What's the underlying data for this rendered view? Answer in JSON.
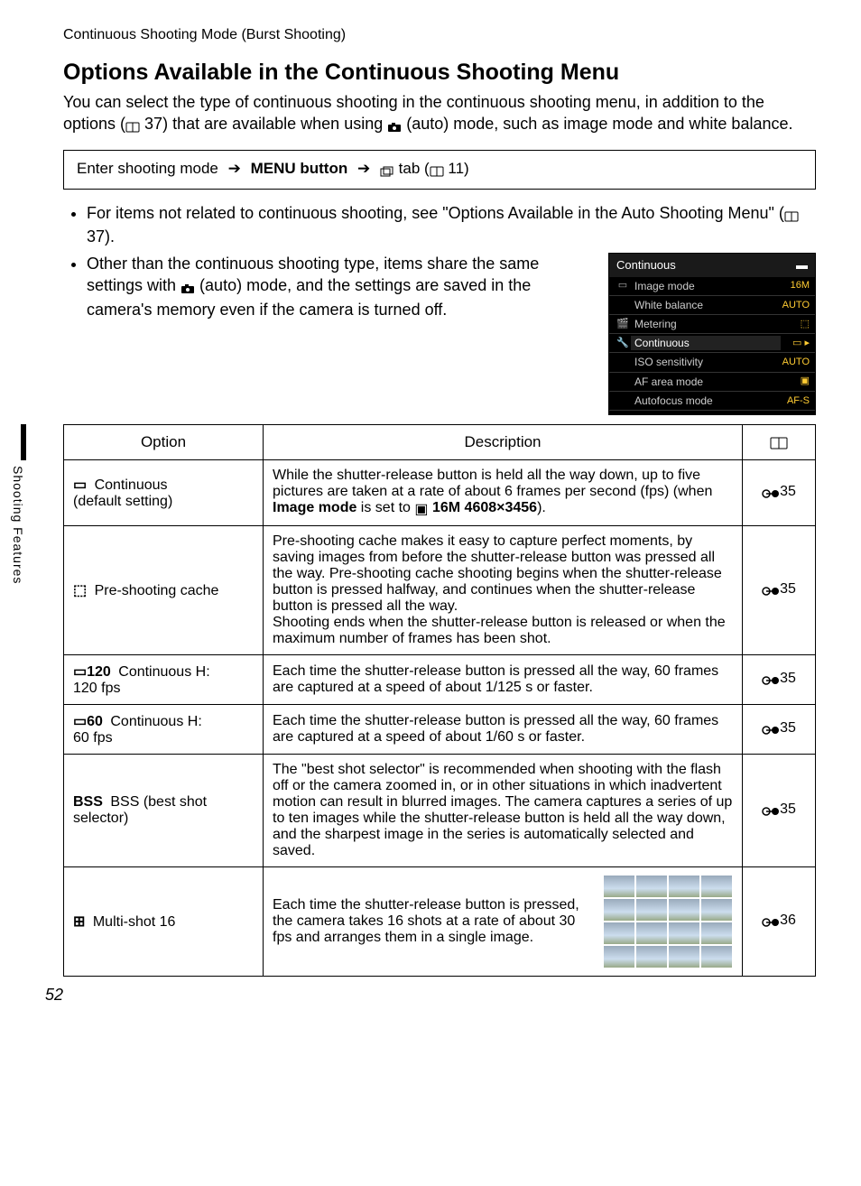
{
  "running_head": "Continuous Shooting Mode (Burst Shooting)",
  "section_title": "Options Available in the Continuous Shooting Menu",
  "intro_a": "You can select the type of continuous shooting in the continuous shooting menu, in addition to the options (",
  "intro_ref1": " 37) that are available when using ",
  "intro_b": " (auto) mode, such as image mode and white balance.",
  "nav": {
    "a": "Enter shooting mode ",
    "b": " MENU button ",
    "c": " tab (",
    "ref": " 11)"
  },
  "bullets": {
    "b1a": "For items not related to continuous shooting, see \"Options Available in the Auto Shooting Menu\" (",
    "b1b": " 37).",
    "b2a": "Other than the continuous shooting type, items share the same settings with ",
    "b2b": " (auto) mode, and the settings are saved in the camera's memory even if the camera is turned off."
  },
  "menu": {
    "title": "Continuous",
    "items": [
      {
        "label": "Image mode",
        "val": "16M"
      },
      {
        "label": "White balance",
        "val": "AUTO"
      },
      {
        "label": "Metering",
        "val": "⬚"
      },
      {
        "label": "Continuous",
        "val": "▭ ▸"
      },
      {
        "label": "ISO sensitivity",
        "val": "AUTO"
      },
      {
        "label": "AF area mode",
        "val": "▣"
      },
      {
        "label": "Autofocus mode",
        "val": "AF-S"
      }
    ]
  },
  "table": {
    "headers": {
      "opt": "Option",
      "desc": "Description",
      "ref": ""
    },
    "rows": [
      {
        "opt_icon": "▭",
        "opt_a": " Continuous",
        "opt_b": "(default setting)",
        "desc_a": "While the shutter-release button is held all the way down, up to five pictures are taken at a rate of about 6 frames per second (fps) (when ",
        "desc_bold1": "Image mode",
        "desc_b": " is set to ",
        "desc_bold2": "16M 4608×3456",
        "desc_c": ").",
        "ref": "35"
      },
      {
        "opt_icon": "⬚",
        "opt_a": " Pre-shooting cache",
        "opt_b": "",
        "desc_a": "Pre-shooting cache makes it easy to capture perfect moments, by saving images from before the shutter-release button was pressed all the way. Pre-shooting cache shooting begins when the shutter-release button is pressed halfway, and continues when the shutter-release button is pressed all the way.",
        "desc_b": "Shooting ends when the shutter-release button is released or when the maximum number of frames has been shot.",
        "ref": "35"
      },
      {
        "opt_icon": "▭120",
        "opt_a": " Continuous H:",
        "opt_b": "120 fps",
        "desc": "Each time the shutter-release button is pressed all the way, 60 frames are captured at a speed of about 1/125 s or faster.",
        "ref": "35"
      },
      {
        "opt_icon": "▭60",
        "opt_a": " Continuous H:",
        "opt_b": "60 fps",
        "desc": "Each time the shutter-release button is pressed all the way, 60 frames are captured at a speed of about 1/60 s or faster.",
        "ref": "35"
      },
      {
        "opt_icon": "BSS",
        "opt_a": " BSS (best shot",
        "opt_b": "selector)",
        "desc": "The \"best shot selector\" is recommended when shooting with the flash off or the camera zoomed in, or in other situations in which inadvertent motion can result in blurred images. The camera captures a series of up to ten images while the shutter-release button is held all the way down, and the sharpest image in the series is automatically selected and saved.",
        "ref": "35"
      },
      {
        "opt_icon": "⊞",
        "opt_a": " Multi-shot 16",
        "opt_b": "",
        "desc": "Each time the shutter-release button is pressed, the camera takes 16 shots at a rate of about 30 fps and arranges them in a single image.",
        "ref": "36"
      }
    ]
  },
  "side_tab": "Shooting Features",
  "page_num": "52"
}
